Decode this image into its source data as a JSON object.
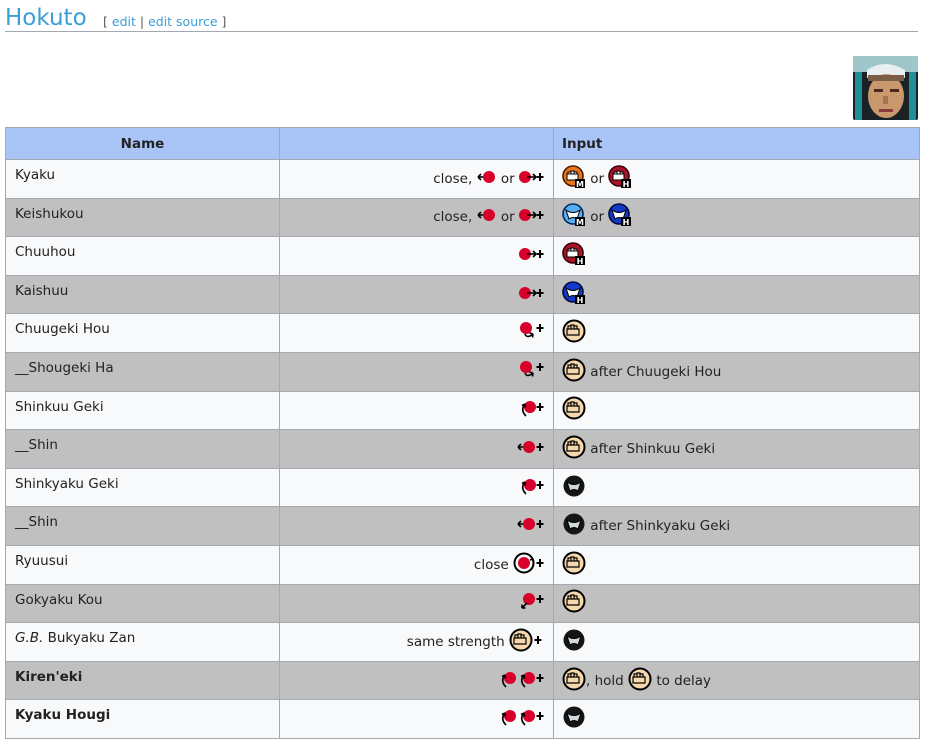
{
  "page": {
    "title": "Hokuto",
    "edit_open": "[",
    "edit_label": "edit",
    "edit_sep": "|",
    "edit_source_label": "edit source",
    "edit_close": "]"
  },
  "table": {
    "headers": {
      "name": "Name",
      "motion": "",
      "input": "Input"
    },
    "rows": [
      {
        "name": "Kyaku",
        "motion_text": "close,",
        "motion_or": "or",
        "input_or": "or"
      },
      {
        "name": "Keishukou",
        "motion_text": "close,",
        "motion_or": "or",
        "input_or": "or"
      },
      {
        "name": "Chuuhou"
      },
      {
        "name": "Kaishuu"
      },
      {
        "name": "Chuugeki Hou"
      },
      {
        "name": "__Shougeki Ha",
        "input_after": "after Chuugeki Hou"
      },
      {
        "name": "Shinkuu Geki"
      },
      {
        "name": "__Shin",
        "input_after": "after Shinkuu Geki"
      },
      {
        "name": "Shinkyaku Geki"
      },
      {
        "name": "__Shin",
        "input_after": "after Shinkyaku Geki"
      },
      {
        "name": "Ryuusui",
        "motion_text": "close"
      },
      {
        "name": "Gokyaku Kou"
      },
      {
        "name_italic": "G.B.",
        "name": "Bukyaku Zan",
        "motion_text": "same strength"
      },
      {
        "name": "Kiren'eki",
        "input_hold": ", hold",
        "input_delay": "to delay"
      },
      {
        "name": "Kyaku Hougi"
      }
    ]
  },
  "icons": {
    "joystick": "joystick-ball-icon",
    "punch": "fist-punch-icon",
    "kick": "kick-icon",
    "colors": {
      "ball": "#d8002a",
      "punch_fill": "#f6d8ae",
      "medium_orange": "#e8761e",
      "heavy_red": "#a8142a",
      "light_blue": "#58aef0",
      "heavy_blue": "#1438c8",
      "black": "#151515"
    }
  }
}
